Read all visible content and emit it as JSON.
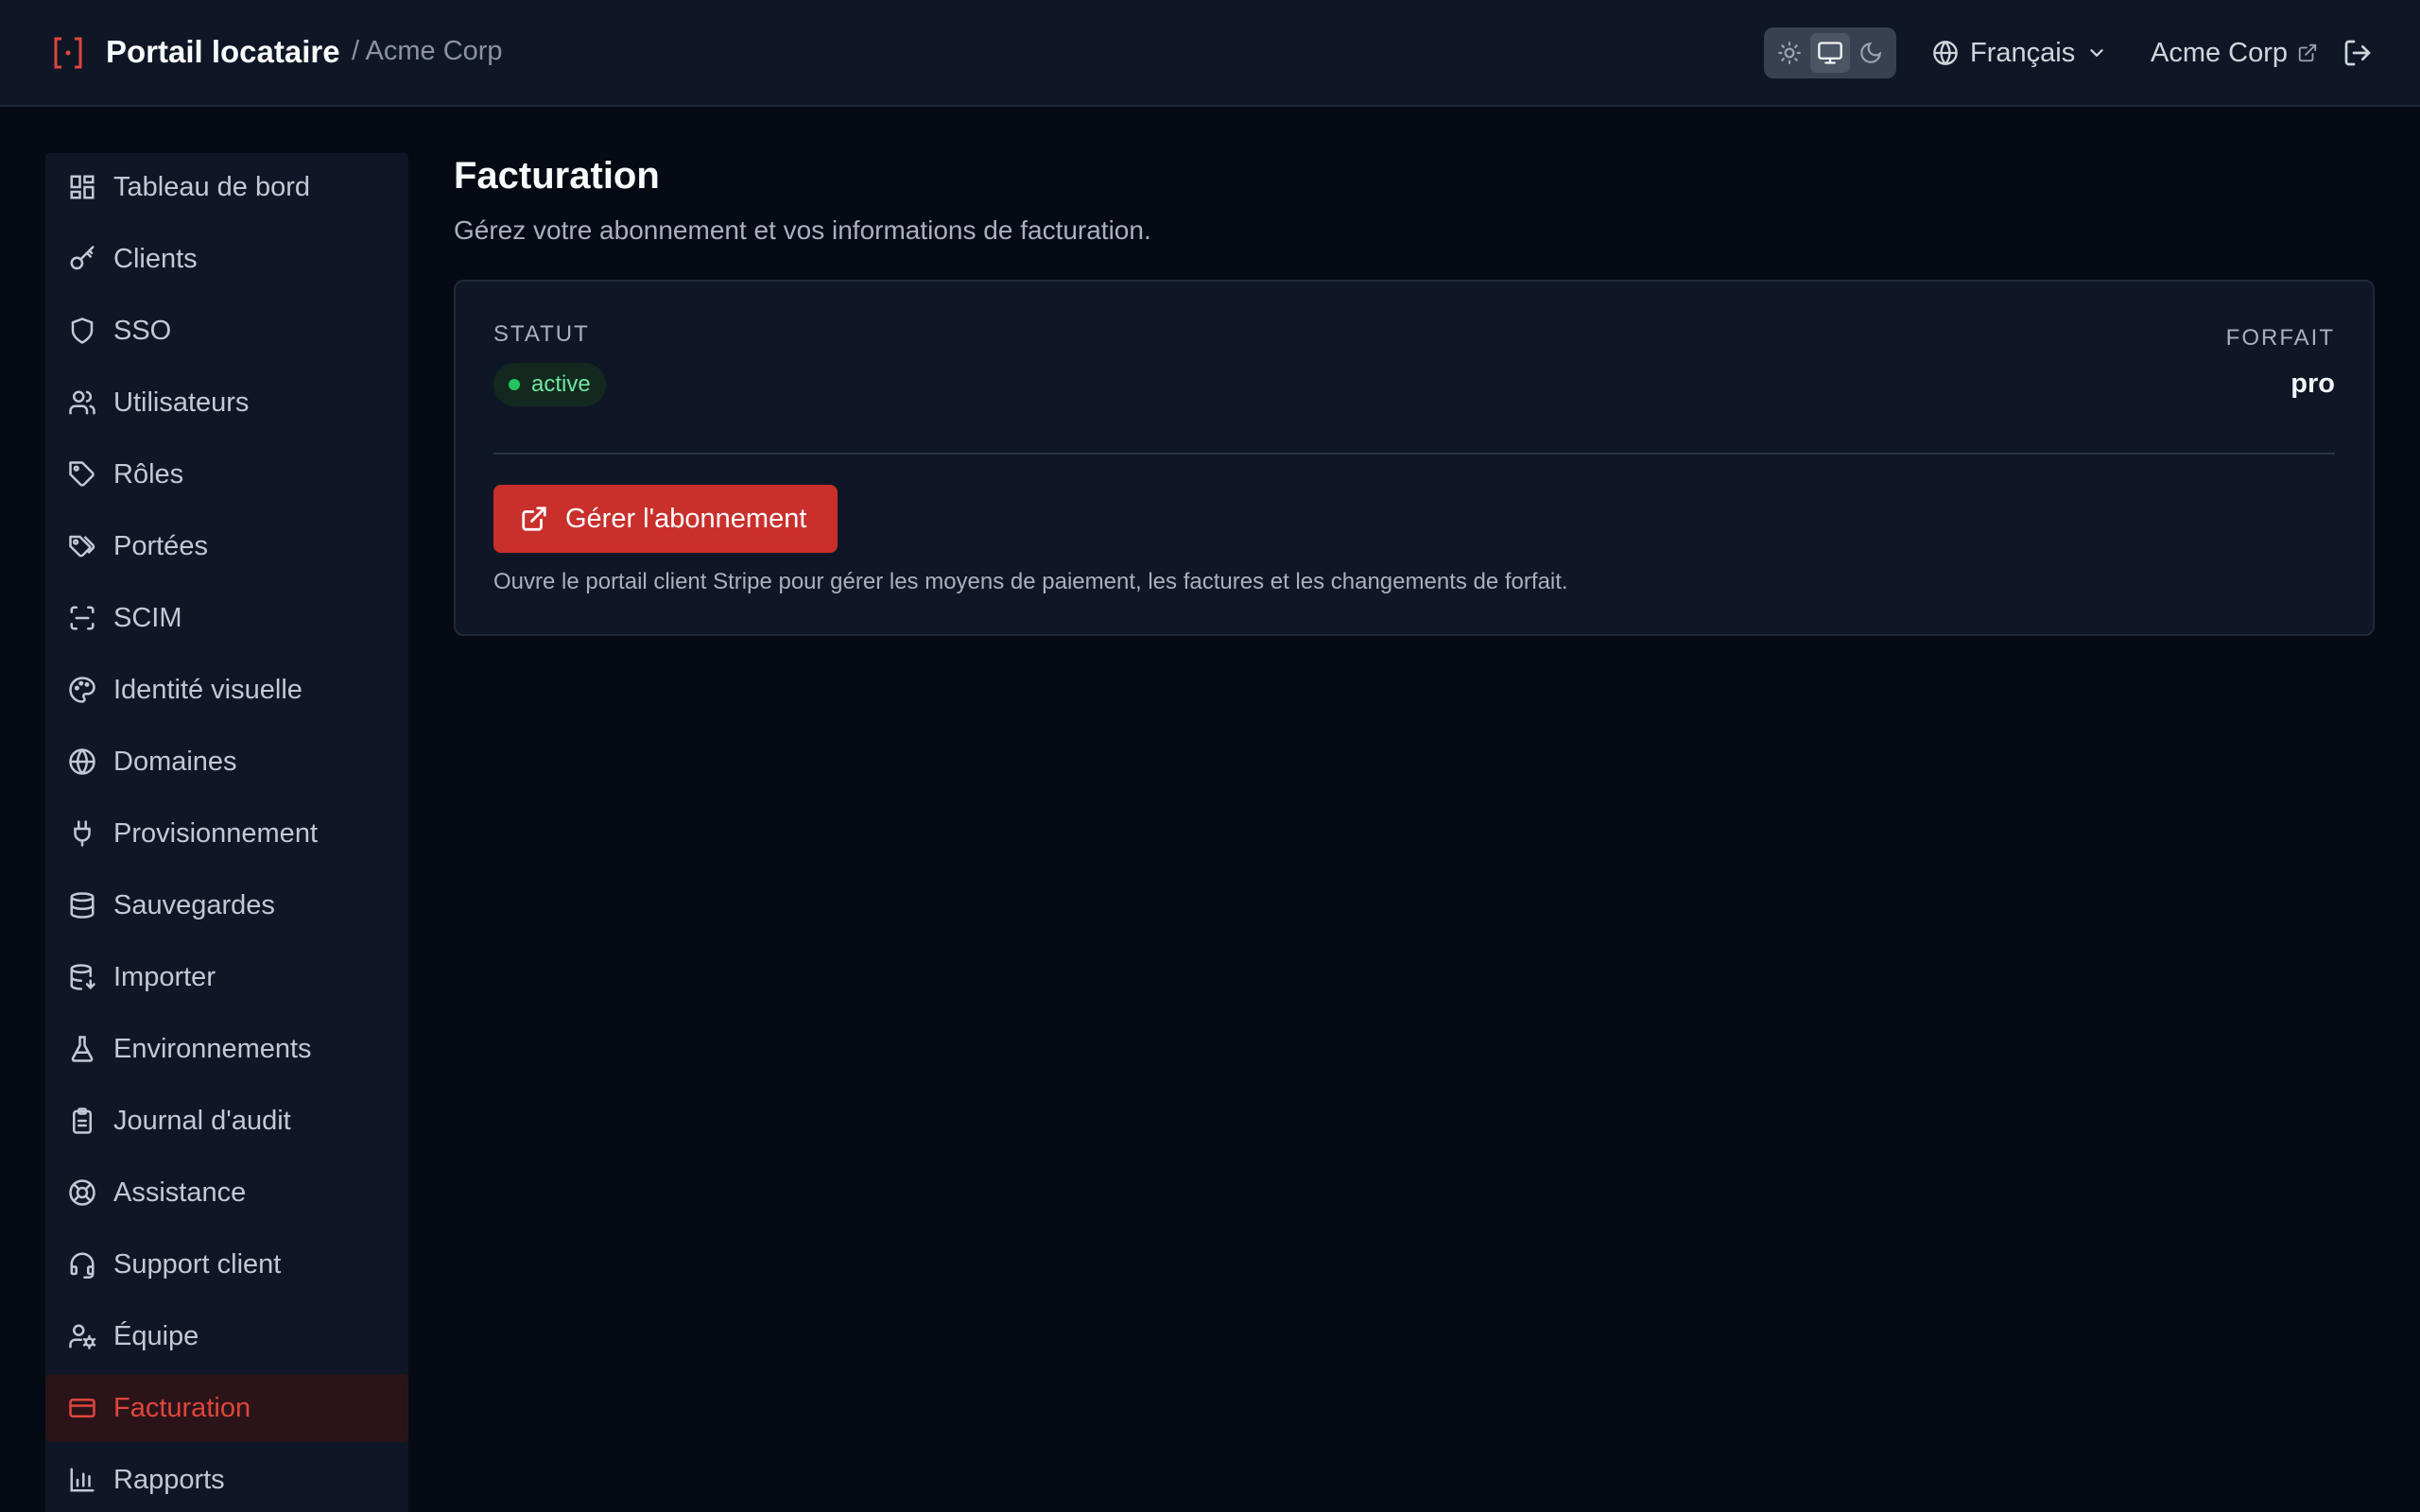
{
  "app": {
    "title": "Portail locataire",
    "breadcrumb": "/ Acme Corp",
    "accent_color": "#c9302c"
  },
  "header": {
    "theme_options": [
      {
        "name": "sun-icon",
        "active": false
      },
      {
        "name": "monitor-icon",
        "active": true
      },
      {
        "name": "moon-icon",
        "active": false
      }
    ],
    "language": "Français",
    "tenant": "Acme Corp"
  },
  "sidebar": {
    "items": [
      {
        "label": "Tableau de bord",
        "icon": "dashboard-icon"
      },
      {
        "label": "Clients",
        "icon": "key-icon"
      },
      {
        "label": "SSO",
        "icon": "shield-icon"
      },
      {
        "label": "Utilisateurs",
        "icon": "users-icon"
      },
      {
        "label": "Rôles",
        "icon": "tag-icon"
      },
      {
        "label": "Portées",
        "icon": "tags-icon"
      },
      {
        "label": "SCIM",
        "icon": "scan-icon"
      },
      {
        "label": "Identité visuelle",
        "icon": "palette-icon"
      },
      {
        "label": "Domaines",
        "icon": "globe-icon"
      },
      {
        "label": "Provisionnement",
        "icon": "plug-icon"
      },
      {
        "label": "Sauvegardes",
        "icon": "database-icon"
      },
      {
        "label": "Importer",
        "icon": "database-import-icon"
      },
      {
        "label": "Environnements",
        "icon": "flask-icon"
      },
      {
        "label": "Journal d'audit",
        "icon": "clipboard-icon"
      },
      {
        "label": "Assistance",
        "icon": "lifebuoy-icon"
      },
      {
        "label": "Support client",
        "icon": "headset-icon"
      },
      {
        "label": "Équipe",
        "icon": "user-cog-icon"
      },
      {
        "label": "Facturation",
        "icon": "credit-card-icon",
        "active": true
      },
      {
        "label": "Rapports",
        "icon": "bar-chart-icon"
      }
    ]
  },
  "main": {
    "title": "Facturation",
    "subtitle": "Gérez votre abonnement et vos informations de facturation.",
    "card": {
      "status_label": "STATUT",
      "status_value": "active",
      "plan_label": "FORFAIT",
      "plan_value": "pro",
      "manage_button": "Gérer l'abonnement",
      "helper_text": "Ouvre le portail client Stripe pour gérer les moyens de paiement, les factures et les changements de forfait."
    }
  }
}
